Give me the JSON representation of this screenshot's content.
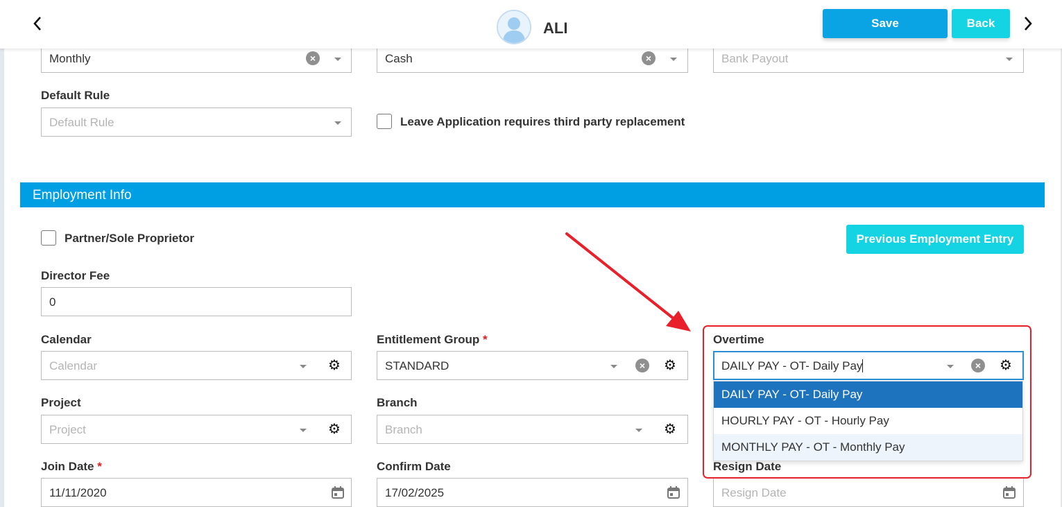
{
  "header": {
    "profile_name": "ALI",
    "save_label": "Save",
    "back_label": "Back"
  },
  "top_fields": {
    "pay_frequency": "Monthly",
    "payment_method": "Cash",
    "bank_payout_placeholder": "Bank Payout",
    "default_rule_label": "Default Rule",
    "default_rule_placeholder": "Default Rule",
    "leave_replacement_label": "Leave Application requires third party replacement",
    "leave_replacement_checked": false
  },
  "employment": {
    "section_title": "Employment Info",
    "partner_label": "Partner/Sole Proprietor",
    "partner_checked": false,
    "prev_employment_label": "Previous Employment Entry",
    "director_fee_label": "Director Fee",
    "director_fee_value": "0",
    "calendar_label": "Calendar",
    "calendar_placeholder": "Calendar",
    "entitlement_label": "Entitlement Group",
    "entitlement_value": "STANDARD",
    "overtime_label": "Overtime",
    "overtime_value": "DAILY PAY - OT- Daily Pay",
    "overtime_options": [
      "DAILY PAY - OT- Daily Pay",
      "HOURLY PAY - OT - Hourly Pay",
      "MONTHLY PAY - OT - Monthly Pay"
    ],
    "project_label": "Project",
    "project_placeholder": "Project",
    "branch_label": "Branch",
    "branch_placeholder": "Branch",
    "join_date_label": "Join Date",
    "join_date_value": "11/11/2020",
    "confirm_date_label": "Confirm Date",
    "confirm_date_value": "17/02/2025",
    "resign_date_label": "Resign Date",
    "resign_date_placeholder": "Resign Date",
    "required_mark": "*"
  },
  "colors": {
    "primary": "#0aa3e3",
    "accent": "#14d3e2",
    "section_bar": "#009fe3",
    "selected_option": "#1e73be",
    "annotation": "#e8202a"
  }
}
